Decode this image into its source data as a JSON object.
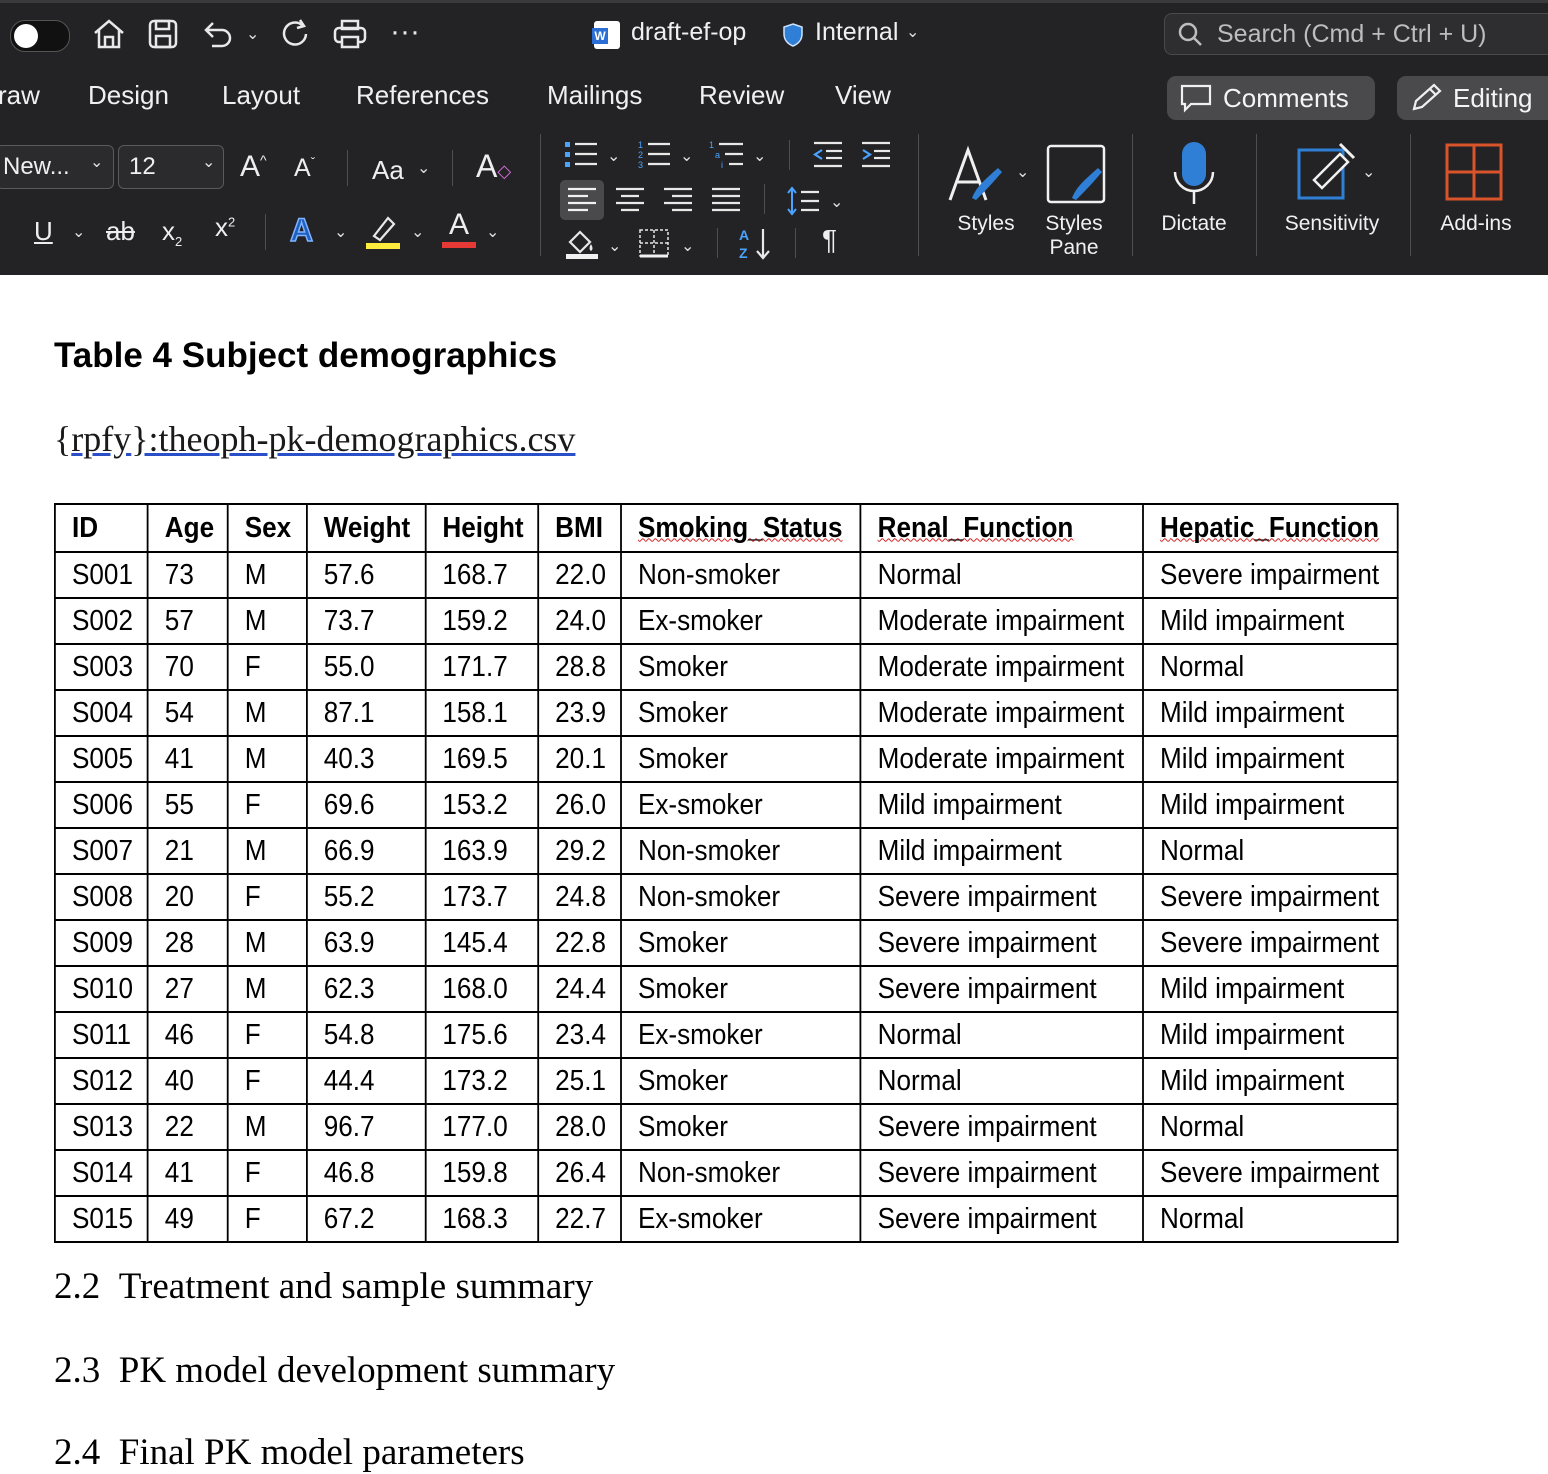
{
  "app": {
    "doc_name": "draft-ef-op",
    "sensitivity_label": "Internal",
    "search_placeholder": "Search (Cmd + Ctrl + U)"
  },
  "tabs": [
    "raw",
    "Design",
    "Layout",
    "References",
    "Mailings",
    "Review",
    "View"
  ],
  "actions": {
    "comments": "Comments",
    "editing": "Editing"
  },
  "font": {
    "name": "New...",
    "size": "12",
    "case_label": "Aa"
  },
  "groups": {
    "styles": "Styles",
    "styles_pane_1": "Styles",
    "styles_pane_2": "Pane",
    "dictate": "Dictate",
    "sensitivity": "Sensitivity",
    "addins": "Add-ins"
  },
  "colors": {
    "ribbon_bg": "#232325",
    "highlight": "#ffeb3b",
    "font_color": "#e53935",
    "accent": "#2f7fd6",
    "addins": "#d9542b"
  },
  "document": {
    "table_title": "Table 4 Subject demographics",
    "link_prefix": "{",
    "link_tag": "rpfy",
    "link_rest": "}:theoph-pk-demographics.csv",
    "columns": [
      "ID",
      "Age",
      "Sex",
      "Weight",
      "Height",
      "BMI",
      "Smoking_Status",
      "Renal_Function",
      "Hepatic_Function"
    ],
    "rows": [
      [
        "S001",
        "73",
        "M",
        "57.6",
        "168.7",
        "22.0",
        "Non-smoker",
        "Normal",
        "Severe impairment"
      ],
      [
        "S002",
        "57",
        "M",
        "73.7",
        "159.2",
        "24.0",
        "Ex-smoker",
        "Moderate impairment",
        "Mild impairment"
      ],
      [
        "S003",
        "70",
        "F",
        "55.0",
        "171.7",
        "28.8",
        "Smoker",
        "Moderate impairment",
        "Normal"
      ],
      [
        "S004",
        "54",
        "M",
        "87.1",
        "158.1",
        "23.9",
        "Smoker",
        "Moderate impairment",
        "Mild impairment"
      ],
      [
        "S005",
        "41",
        "M",
        "40.3",
        "169.5",
        "20.1",
        "Smoker",
        "Moderate impairment",
        "Mild impairment"
      ],
      [
        "S006",
        "55",
        "F",
        "69.6",
        "153.2",
        "26.0",
        "Ex-smoker",
        "Mild impairment",
        "Mild impairment"
      ],
      [
        "S007",
        "21",
        "M",
        "66.9",
        "163.9",
        "29.2",
        "Non-smoker",
        "Mild impairment",
        "Normal"
      ],
      [
        "S008",
        "20",
        "F",
        "55.2",
        "173.7",
        "24.8",
        "Non-smoker",
        "Severe impairment",
        "Severe impairment"
      ],
      [
        "S009",
        "28",
        "M",
        "63.9",
        "145.4",
        "22.8",
        "Smoker",
        "Severe impairment",
        "Severe impairment"
      ],
      [
        "S010",
        "27",
        "M",
        "62.3",
        "168.0",
        "24.4",
        "Smoker",
        "Severe impairment",
        "Mild impairment"
      ],
      [
        "S011",
        "46",
        "F",
        "54.8",
        "175.6",
        "23.4",
        "Ex-smoker",
        "Normal",
        "Mild impairment"
      ],
      [
        "S012",
        "40",
        "F",
        "44.4",
        "173.2",
        "25.1",
        "Smoker",
        "Normal",
        "Mild impairment"
      ],
      [
        "S013",
        "22",
        "M",
        "96.7",
        "177.0",
        "28.0",
        "Smoker",
        "Severe impairment",
        "Normal"
      ],
      [
        "S014",
        "41",
        "F",
        "46.8",
        "159.8",
        "26.4",
        "Non-smoker",
        "Severe impairment",
        "Severe impairment"
      ],
      [
        "S015",
        "49",
        "F",
        "67.2",
        "168.3",
        "22.7",
        "Ex-smoker",
        "Severe impairment",
        "Normal"
      ]
    ],
    "headings": [
      {
        "num": "2.2",
        "text": "Treatment and sample summary"
      },
      {
        "num": "2.3",
        "text": "PK model development summary"
      },
      {
        "num": "2.4",
        "text": "Final PK model parameters"
      }
    ]
  }
}
